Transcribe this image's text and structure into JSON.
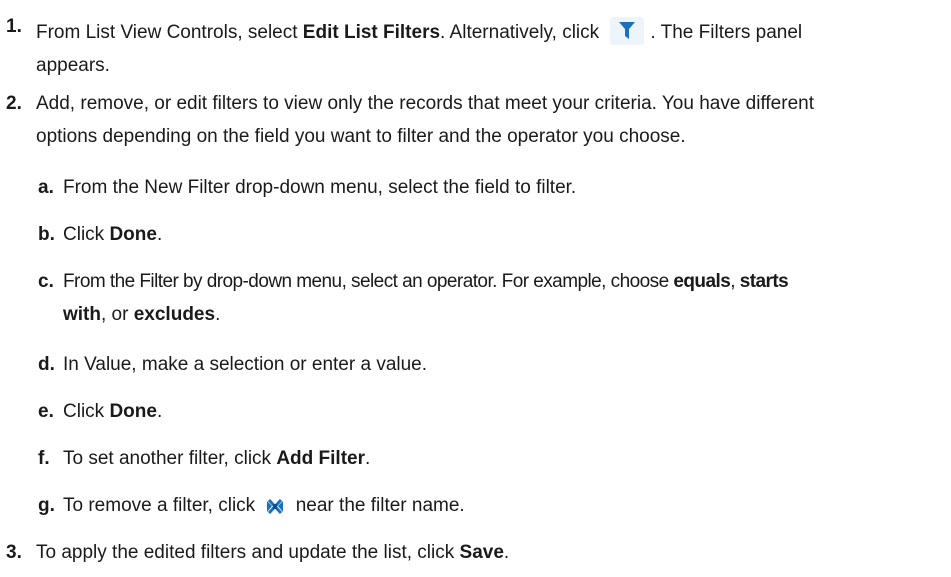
{
  "steps": [
    {
      "num": "1.",
      "line1": {
        "a": "From List View Controls, select ",
        "b": "Edit List Filters",
        "c": ". Alternatively, click ",
        "d": ". The Filters panel"
      },
      "line2": "appears."
    },
    {
      "num": "2.",
      "line1": "Add, remove, or edit filters to view only the records that meet your criteria. You have different",
      "line2": "options depending on the field you want to filter and the operator you choose."
    },
    {
      "num": "3.",
      "a": "To apply the edited filters and update the list, click ",
      "b": "Save",
      "c": "."
    }
  ],
  "substeps": [
    {
      "letter": "a.",
      "text": "From the New Filter drop-down menu, select the field to filter."
    },
    {
      "letter": "b.",
      "pre": "Click ",
      "bold": "Done",
      "post": "."
    },
    {
      "letter": "c.",
      "line1": {
        "a": "From the Filter by drop-down menu, select an operator. For example, choose ",
        "b": "equals",
        "c": ", ",
        "d": "starts"
      },
      "line2": {
        "b": "with",
        "c": ", or ",
        "d": "excludes",
        "e": "."
      }
    },
    {
      "letter": "d.",
      "text": "In Value, make a selection or enter a value."
    },
    {
      "letter": "e.",
      "pre": "Click ",
      "bold": "Done",
      "post": "."
    },
    {
      "letter": "f.",
      "pre": "To set another filter, click ",
      "bold": "Add Filter",
      "post": "."
    },
    {
      "letter": "g.",
      "pre": "To remove a filter, click ",
      "post": " near the filter name."
    }
  ],
  "icons": {
    "filter": "filter-funnel-icon",
    "remove": "remove-filter-icon"
  },
  "colors": {
    "icon_blue": "#1c6fbf",
    "icon_bg": "#edf4fa",
    "text": "#1a1a1a"
  }
}
